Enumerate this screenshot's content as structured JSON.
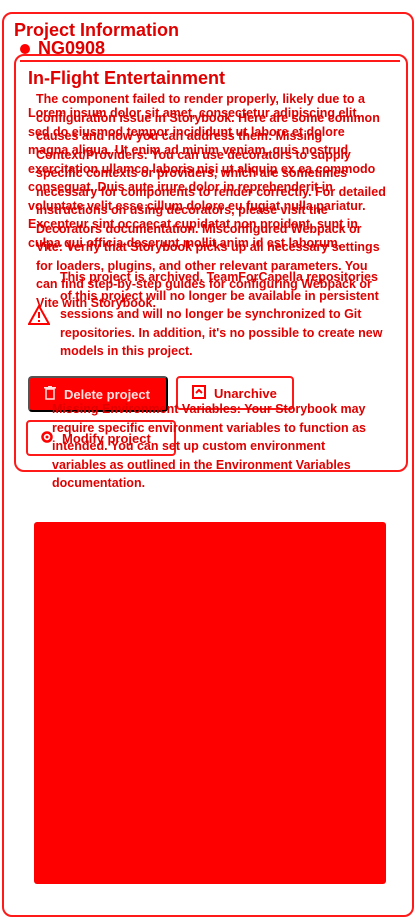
{
  "header": {
    "title": "Project Information",
    "project_code": "NG0908"
  },
  "card": {
    "title": "In-Flight Entertainment",
    "lorem": "Lorem ipsum dolor sit amet, consectetur adipiscing elit, sed do eiusmod tempor incididunt ut labore et dolore magna aliqua. Ut enim ad minim veniam, quis nostrud exercitation ullamco laboris nisi ut aliquip ex ea commodo consequat. Duis aute irure dolor in reprehenderit in voluptate velit esse cillum dolore eu fugiat nulla pariatur. Excepteur sint occaecat cupidatat non proident, sunt in culpa qui officia deserunt mollit anim id est laborum.",
    "error_message": "The component failed to render properly, likely due to a configuration issue in Storybook. Here are some common causes and how you can address them: Missing Context/Providers: You can use decorators to supply specific contexts or providers, which are sometimes necessary for components to render correctly. For detailed instructions on using decorators, please visit the Decorators documentation. Misconfigured Webpack or Vite: Verify that Storybook picks up all necessary settings for loaders, plugins, and other relevant parameters. You can find step-by-step guides for configuring Webpack or Vite with Storybook.",
    "archive_notice": "This project is archived. TeamForCapella repositories of this project will no longer be available in persistent sessions and will no longer be synchronized to Git repositories. In addition, it's no possible to create new models in this project.",
    "env_notice": "Missing Environment Variables: Your Storybook may require specific environment variables to function as intended. You can set up custom environment variables as outlined in the Environment Variables documentation."
  },
  "actions": {
    "delete_label": "Delete project",
    "unarchive_label": "Unarchive",
    "modify_label": "Modify project"
  },
  "icons": {
    "warning": "warning-icon",
    "delete": "trash-icon",
    "unarchive": "unarchive-icon",
    "modify": "gear-icon"
  },
  "colors": {
    "accent": "#ff0000",
    "text": "#e00000"
  }
}
